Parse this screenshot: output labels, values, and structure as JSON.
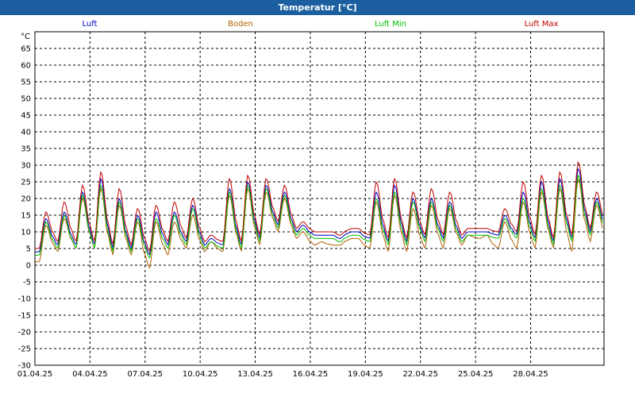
{
  "window_title": "Temperatur [°C]",
  "chart_data": {
    "type": "line",
    "title": "Temperatur [°C]",
    "ylabel": "°C",
    "ylim": [
      -30,
      70
    ],
    "yticks": [
      -30,
      -25,
      -20,
      -15,
      -10,
      -5,
      0,
      5,
      10,
      15,
      20,
      25,
      30,
      35,
      40,
      45,
      50,
      55,
      60,
      65
    ],
    "xlabels": [
      "01.04.25",
      "04.04.25",
      "07.04.25",
      "10.04.25",
      "13.04.25",
      "16.04.25",
      "19.04.25",
      "22.04.25",
      "25.04.25",
      "28.04.25"
    ],
    "xlim_days": [
      0,
      31
    ],
    "grid": true,
    "legend_position": "top",
    "days": [
      0,
      1,
      2,
      3,
      4,
      5,
      6,
      7,
      8,
      9,
      10,
      11,
      12,
      13,
      14,
      15,
      16,
      17,
      18,
      19,
      20,
      21,
      22,
      23,
      24,
      25,
      26,
      27,
      28,
      29,
      30
    ],
    "series": [
      {
        "name": "Luft",
        "color": "#0000c0",
        "daily_min": [
          4,
          6,
          6,
          6,
          5,
          5,
          3,
          6,
          7,
          6,
          6,
          6,
          8,
          12,
          10,
          9,
          9,
          10,
          8,
          7,
          7,
          8,
          8,
          8,
          10,
          9,
          9,
          8,
          7,
          8,
          10
        ],
        "daily_max": [
          14,
          16,
          22,
          26,
          20,
          15,
          16,
          16,
          18,
          8,
          23,
          25,
          24,
          22,
          12,
          9,
          8,
          10,
          22,
          24,
          20,
          20,
          19,
          10,
          10,
          15,
          22,
          25,
          26,
          29,
          20
        ]
      },
      {
        "name": "Boden",
        "color": "#b06000",
        "daily_min": [
          1,
          4,
          5,
          5,
          3,
          3,
          -1,
          3,
          5,
          4,
          4,
          4,
          6,
          10,
          8,
          6,
          6,
          8,
          5,
          4,
          4,
          5,
          5,
          6,
          8,
          5,
          5,
          5,
          5,
          4,
          7
        ],
        "daily_max": [
          12,
          14,
          20,
          23,
          18,
          13,
          13,
          13,
          15,
          7,
          21,
          23,
          22,
          20,
          10,
          7,
          6,
          8,
          19,
          21,
          17,
          18,
          17,
          9,
          9,
          13,
          19,
          22,
          23,
          26,
          18
        ]
      },
      {
        "name": "Luft Min",
        "color": "#00c000",
        "daily_min": [
          3,
          5,
          5,
          5,
          4,
          4,
          2,
          5,
          6,
          5,
          5,
          5,
          7,
          11,
          9,
          8,
          8,
          9,
          7,
          6,
          6,
          7,
          7,
          7,
          9,
          8,
          8,
          7,
          6,
          7,
          9
        ],
        "daily_max": [
          13,
          15,
          21,
          24,
          19,
          14,
          14,
          15,
          17,
          7,
          22,
          24,
          23,
          21,
          11,
          8,
          7,
          9,
          20,
          22,
          19,
          19,
          18,
          9,
          9,
          14,
          20,
          23,
          24,
          27,
          19
        ]
      },
      {
        "name": "Luft Max",
        "color": "#c00000",
        "daily_min": [
          5,
          7,
          7,
          7,
          6,
          6,
          4,
          7,
          8,
          7,
          7,
          7,
          9,
          13,
          11,
          10,
          10,
          11,
          9,
          8,
          8,
          9,
          9,
          9,
          11,
          10,
          10,
          9,
          8,
          9,
          11
        ],
        "daily_max": [
          16,
          19,
          24,
          28,
          23,
          17,
          18,
          19,
          20,
          9,
          26,
          27,
          26,
          24,
          13,
          10,
          9,
          11,
          25,
          26,
          22,
          23,
          22,
          11,
          11,
          17,
          25,
          27,
          28,
          31,
          22
        ]
      }
    ]
  }
}
